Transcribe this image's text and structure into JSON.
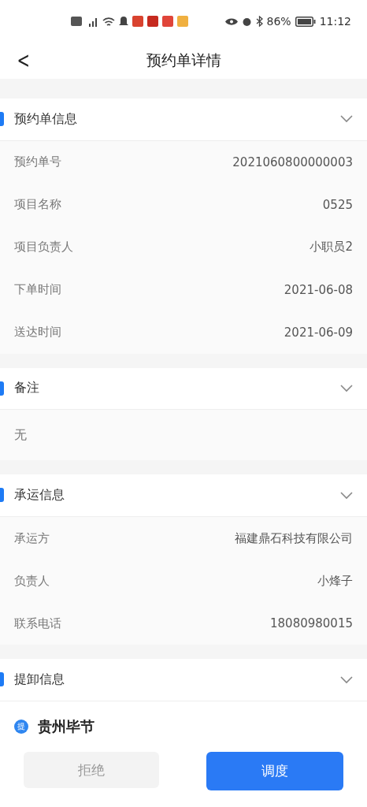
{
  "status_bar": {
    "battery": "86%",
    "time": "11:12"
  },
  "header": {
    "back": "<",
    "title": "预约单详情"
  },
  "sections": [
    {
      "kind": "fields",
      "title": "预约单信息",
      "rows": [
        {
          "label": "预约单号",
          "value": "2021060800000003"
        },
        {
          "label": "项目名称",
          "value": "0525"
        },
        {
          "label": "项目负责人",
          "value": "小职员2"
        },
        {
          "label": "下单时间",
          "value": "2021-06-08"
        },
        {
          "label": "送达时间",
          "value": "2021-06-09"
        }
      ]
    },
    {
      "kind": "note",
      "title": "备注",
      "text": "无"
    },
    {
      "kind": "fields",
      "title": "承运信息",
      "rows": [
        {
          "label": "承运方",
          "value": "福建鼎石科技有限公司"
        },
        {
          "label": "负责人",
          "value": "小烽子"
        },
        {
          "label": "联系电话",
          "value": "18080980015"
        }
      ]
    },
    {
      "kind": "pickup",
      "title": "提卸信息",
      "badge": "提",
      "place": "贵州毕节"
    }
  ],
  "buttons": [
    {
      "label": "拒绝",
      "primary": false
    },
    {
      "label": "调度",
      "primary": true
    }
  ]
}
